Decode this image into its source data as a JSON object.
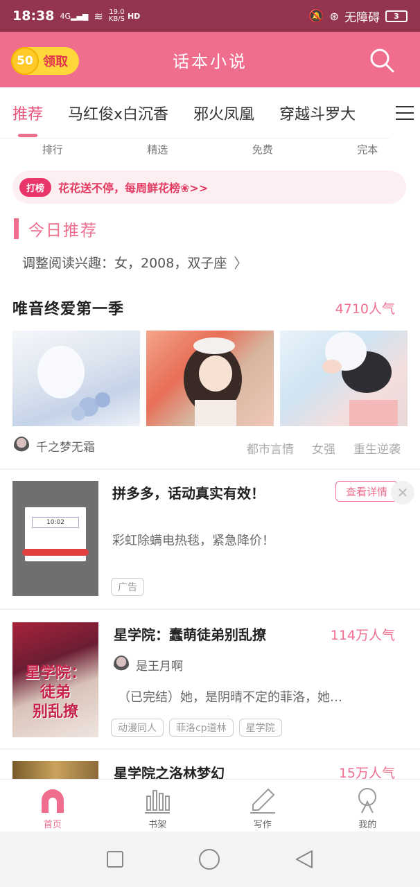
{
  "status_bar": {
    "time": "18:38",
    "signal": "4G",
    "speed_value": "19.0",
    "speed_unit": "KB/S",
    "hd": "HD",
    "accessibility": "无障碍",
    "battery": "3"
  },
  "header": {
    "coin_value": "50",
    "claim_label": "领取",
    "title": "话本小说",
    "search_icon": "search-icon"
  },
  "tabs": [
    {
      "label": "推荐",
      "active": true
    },
    {
      "label": "马红俊x白沉香",
      "active": false
    },
    {
      "label": "邪火凤凰",
      "active": false
    },
    {
      "label": "穿越斗罗大",
      "active": false
    }
  ],
  "subnav": [
    "排行",
    "精选",
    "免费",
    "完本"
  ],
  "banner": {
    "tag": "打榜",
    "text": "花花送不停，每周鲜花榜❀>>"
  },
  "today": {
    "title": "今日推荐",
    "preference": "调整阅读兴趣：女，2008，双子座"
  },
  "featured": {
    "title": "唯音终爱第一季",
    "popularity": "4710人气",
    "author": "千之梦无霜",
    "tags": [
      "都市言情",
      "女强",
      "重生逆袭"
    ]
  },
  "ad": {
    "title": "拼多多，话动真实有效！",
    "detail_button": "查看详情",
    "description": "彩虹除螨电热毯，紧急降价！",
    "tag": "广告",
    "thumb_time": "10:02"
  },
  "book1": {
    "title": "星学院：蠢萌徒弟别乱撩",
    "popularity": "114万人气",
    "author": "是王月啊",
    "description": "（已完结）她，是阴晴不定的菲洛，她…",
    "tags": [
      "动漫同人",
      "菲洛cp道林",
      "星学院"
    ],
    "cover_text_1": "星学院：",
    "cover_text_2": "徒弟",
    "cover_text_3": "别乱撩"
  },
  "book2": {
    "title": "星学院之洛林梦幻",
    "popularity": "15万人气"
  },
  "bottom_nav": [
    {
      "label": "首页",
      "icon": "home-icon",
      "active": true
    },
    {
      "label": "书架",
      "icon": "bookshelf-icon",
      "active": false
    },
    {
      "label": "写作",
      "icon": "pen-icon",
      "active": false
    },
    {
      "label": "我的",
      "icon": "profile-icon",
      "active": false
    }
  ],
  "colors": {
    "brand": "#ef6e8e",
    "status_bar": "#93354f",
    "coin": "#ffd73b"
  }
}
